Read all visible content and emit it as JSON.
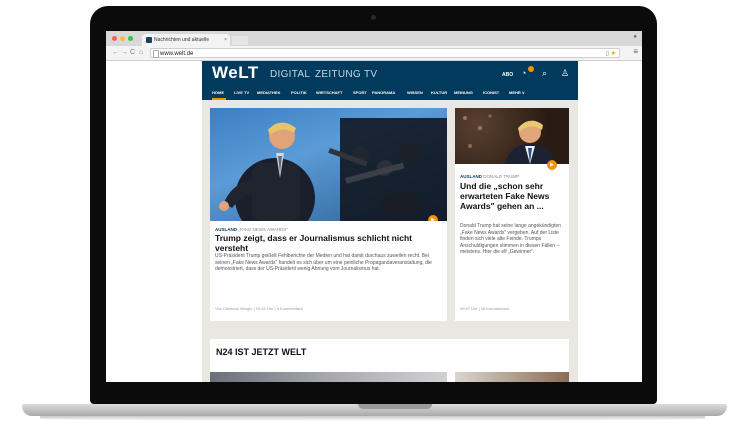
{
  "browser": {
    "tab_title": "Nachrichten und aktuelle",
    "tab_close": "×",
    "url": "www.welt.de",
    "nav_back": "←",
    "nav_forward": "→",
    "nav_reload": "C",
    "nav_home": "⌂"
  },
  "site": {
    "logo": "WeLT",
    "sections": [
      "DIGITAL",
      "ZEITUNG",
      "TV"
    ],
    "abo_label": "ABO",
    "nav": [
      "HOME",
      "LIVE TV",
      "MEDIATHEK",
      "POLITIK",
      "WIRTSCHAFT",
      "SPORT",
      "PANORAMA",
      "WISSEN",
      "KULTUR",
      "MEINUNG",
      "ICONIST",
      "MEHR ∨"
    ]
  },
  "main_article": {
    "kicker_section": "AUSLAND",
    "kicker_topic": "„FAKE NEWS AWARDS\"",
    "headline": "Trump zeigt, dass er Journalismus schlicht nicht versteht",
    "teaser": "US-Präsident Trump geißelt Fehlberichte der Medien und hat damit durchaus zuweilen recht. Bei seinen „Fake News Awards\" handelt es sich über um eine peinliche Propagandaveranstaltung, die demonstriert, dass der US-Präsident wenig Ahnung vom Journalismus hat.",
    "meta": "Von Clemens Wergin | 09:44 Uhr | 5 Kommentare"
  },
  "side_article": {
    "kicker_section": "AUSLAND",
    "kicker_topic": "DONALD TRUMP",
    "headline": "Und die „schon sehr erwarteten Fake News Awards\" gehen an ...",
    "teaser": "Donald Trump hat seine lange angekündigten „Fake News Awards\" vergeben. Auf der Liste finden sich viele alte Feinde. Trumps Anschuldigungen stimmen in diesen Fällen – meistens. Hier die elf „Gewinner\".",
    "meta": "09:47 Uhr | 26 Kommentare"
  },
  "promo": {
    "title": "N24 IST JETZT WELT"
  },
  "colors": {
    "brand_navy": "#003a5d",
    "accent_orange": "#f39200"
  }
}
